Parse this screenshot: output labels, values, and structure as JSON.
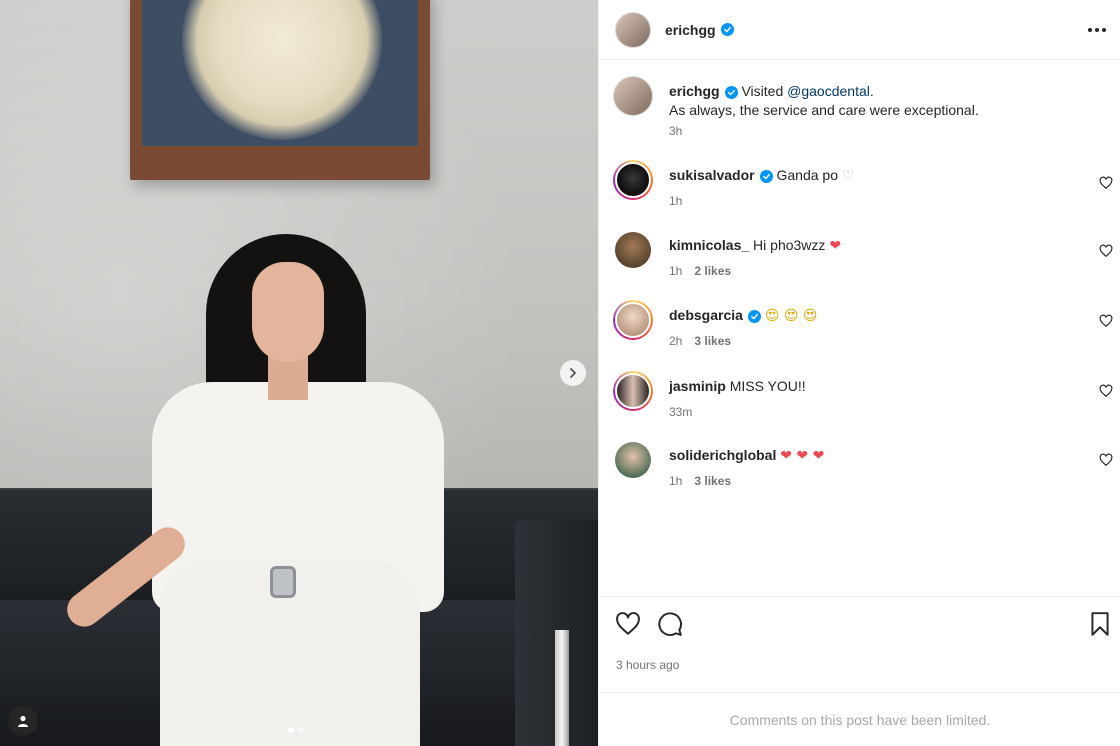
{
  "post": {
    "author": "erichgg",
    "verified": true,
    "caption_prefix": "Visited ",
    "caption_mention": "@gaocdental",
    "caption_suffix": ".",
    "caption_line2": "As always, the service and care were exceptional.",
    "caption_time": "3h",
    "carousel_count": 2,
    "carousel_index": 1
  },
  "icons": {
    "more": "more-options-icon",
    "verified": "verified-badge-icon",
    "like": "heart-icon",
    "comment": "comment-icon",
    "save": "bookmark-icon",
    "next": "chevron-right-icon",
    "tag": "user-tag-icon"
  },
  "comments": [
    {
      "user": "sukisalvador",
      "verified": true,
      "text": "Ganda po ",
      "emoji": "♡",
      "time": "1h",
      "likes": "",
      "ring": true
    },
    {
      "user": "kimnicolas_",
      "verified": false,
      "text": "Hi pho3wzz ",
      "emoji": "❤",
      "time": "1h",
      "likes": "2 likes",
      "ring": false
    },
    {
      "user": "debsgarcia",
      "verified": true,
      "text": "",
      "emoji": "😍 😍 😍",
      "time": "2h",
      "likes": "3 likes",
      "ring": true
    },
    {
      "user": "jasminip",
      "verified": false,
      "text": "MISS YOU!!",
      "emoji": "",
      "time": "33m",
      "likes": "",
      "ring": true
    },
    {
      "user": "soliderichglobal",
      "verified": false,
      "text": "",
      "emoji": "❤ ❤ ❤",
      "time": "1h",
      "likes": "3 likes",
      "ring": false
    }
  ],
  "footer": {
    "posted_ago": "3 hours ago",
    "limited_notice": "Comments on this post have been limited."
  },
  "colors": {
    "verified_blue": "#0095f6",
    "mention": "#00376b",
    "heart_red": "#ed4956",
    "secondary_text": "#737373"
  }
}
